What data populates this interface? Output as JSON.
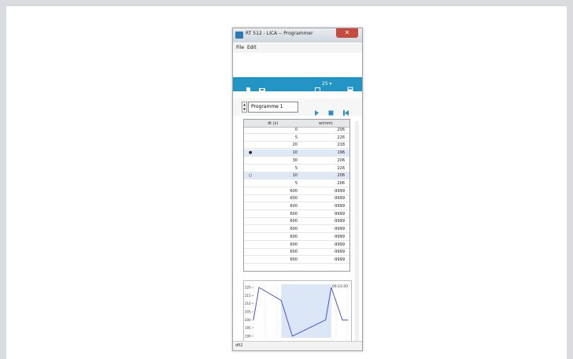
{
  "window": {
    "title": "RT 512 - LICA -- Programmer",
    "close": "✕"
  },
  "menu": {
    "file": "File",
    "edit": "Edit"
  },
  "toolbar": {
    "new_icon": "new-file-icon",
    "save_icon": "save-icon",
    "monitor_label": "25 ▾",
    "accent": "#2395c4"
  },
  "program": {
    "name": "Programme 1"
  },
  "table": {
    "headers": [
      "dt (s)",
      "w(mm)"
    ],
    "rows": [
      {
        "mark": "",
        "dt": "0",
        "w": "206"
      },
      {
        "mark": "",
        "dt": "5",
        "w": "226"
      },
      {
        "mark": "",
        "dt": "20",
        "w": "218"
      },
      {
        "mark": "●",
        "dt": "10",
        "w": "196"
      },
      {
        "mark": "",
        "dt": "30",
        "w": "206"
      },
      {
        "mark": "",
        "dt": "5",
        "w": "226"
      },
      {
        "mark": "○",
        "dt": "10",
        "w": "206"
      },
      {
        "mark": "",
        "dt": "5",
        "w": "206"
      },
      {
        "mark": "",
        "dt": "600",
        "w": "-9999"
      },
      {
        "mark": "",
        "dt": "600",
        "w": "-9999"
      },
      {
        "mark": "",
        "dt": "600",
        "w": "-9999"
      },
      {
        "mark": "",
        "dt": "600",
        "w": "-9999"
      },
      {
        "mark": "",
        "dt": "600",
        "w": "-9999"
      },
      {
        "mark": "",
        "dt": "600",
        "w": "-9999"
      },
      {
        "mark": "",
        "dt": "600",
        "w": "-9999"
      },
      {
        "mark": "",
        "dt": "600",
        "w": "-9999"
      },
      {
        "mark": "",
        "dt": "600",
        "w": "-9999"
      },
      {
        "mark": "",
        "dt": "600",
        "w": "-9999"
      }
    ]
  },
  "chart": {
    "time_label": "00:23:20",
    "y_ticks": [
      "220",
      "215",
      "210",
      "205",
      "200",
      "195",
      "190"
    ],
    "series_color": "#4b55c9",
    "shade_color": "#dbe6f6",
    "points": [
      {
        "x": 0,
        "y": 200
      },
      {
        "x": 5,
        "y": 220
      },
      {
        "x": 25,
        "y": 212
      },
      {
        "x": 35,
        "y": 190
      },
      {
        "x": 65,
        "y": 200
      },
      {
        "x": 70,
        "y": 220
      },
      {
        "x": 80,
        "y": 200
      },
      {
        "x": 85,
        "y": 200
      }
    ],
    "xlim": [
      0,
      85
    ],
    "ylim": [
      189,
      222
    ],
    "shade": [
      25,
      70
    ]
  },
  "status": {
    "text": "dfi2"
  }
}
